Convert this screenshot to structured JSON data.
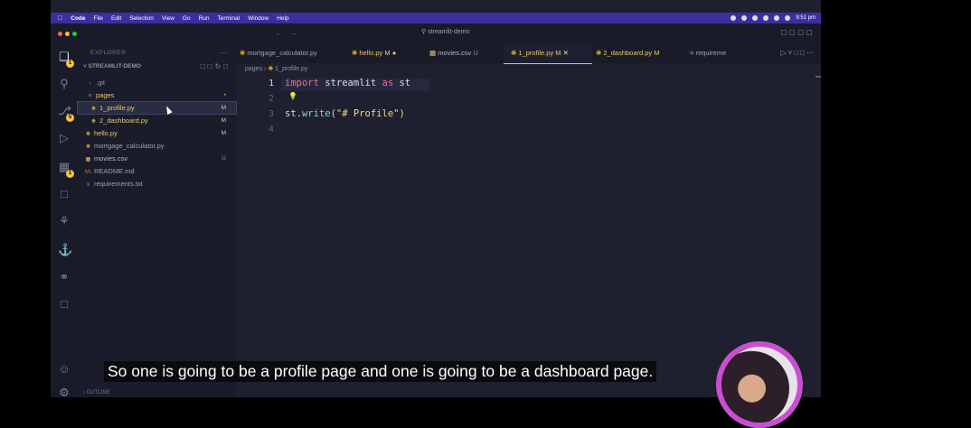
{
  "menubar": {
    "app": "Code",
    "items": [
      "File",
      "Edit",
      "Selection",
      "View",
      "Go",
      "Run",
      "Terminal",
      "Window",
      "Help"
    ],
    "time": "9:51 pm"
  },
  "titlebar": {
    "search": "streamlit-demo"
  },
  "activity": {
    "icons": [
      "files-icon",
      "search-icon",
      "source-control-icon",
      "run-debug-icon",
      "extensions-icon",
      "remote-explorer-icon",
      "testing-icon",
      "docker-icon",
      "git-graph-icon",
      "chat-icon",
      "account-icon",
      "settings-icon"
    ],
    "badges": {
      "files": "1",
      "source_control": "5",
      "extensions": "1"
    }
  },
  "sidebar": {
    "header": "EXPLORER",
    "root": "STREAMLIT-DEMO",
    "items": [
      {
        "label": ".git",
        "status": "",
        "icon": "chevron-right-icon"
      },
      {
        "label": "pages",
        "status": "•",
        "icon": "chevron-down-icon"
      },
      {
        "label": "1_profile.py",
        "status": "M",
        "icon": "python-icon"
      },
      {
        "label": "2_dashboard.py",
        "status": "M",
        "icon": "python-icon"
      },
      {
        "label": "hello.py",
        "status": "M",
        "icon": "python-icon"
      },
      {
        "label": "mortgage_calculator.py",
        "status": "",
        "icon": "python-icon"
      },
      {
        "label": "movies.csv",
        "status": "U",
        "icon": "csv-icon"
      },
      {
        "label": "README.md",
        "status": "",
        "icon": "markdown-icon"
      },
      {
        "label": "requirements.txt",
        "status": "",
        "icon": "text-file-icon"
      }
    ],
    "outline": "OUTLINE"
  },
  "tabs": [
    {
      "label": "mortgage_calculator.py",
      "mod": ""
    },
    {
      "label": "hello.py",
      "mod": "M"
    },
    {
      "label": "movies.csv",
      "mod": "U"
    },
    {
      "label": "1_profile.py",
      "mod": "M"
    },
    {
      "label": "2_dashboard.py",
      "mod": "M"
    },
    {
      "label": "requireme",
      "mod": ""
    }
  ],
  "breadcrumb": {
    "folder": "pages",
    "file": "1_profile.py"
  },
  "editor": {
    "line_numbers": [
      "1",
      "2",
      "3",
      "4"
    ],
    "line1": {
      "kw1": "import",
      "mod": "streamlit",
      "kw2": "as",
      "alias": "st"
    },
    "line3": {
      "obj": "st",
      "fn": "write",
      "open": "(",
      "str": "\"# Profile\"",
      "close": ")"
    }
  },
  "caption": "So one is going to be a profile page and one is going to be a dashboard page.",
  "colors": {
    "accent": "#f5c542",
    "menubar": "#3b2fa0",
    "keyword": "#f06a8a",
    "string": "#f5d77a"
  }
}
